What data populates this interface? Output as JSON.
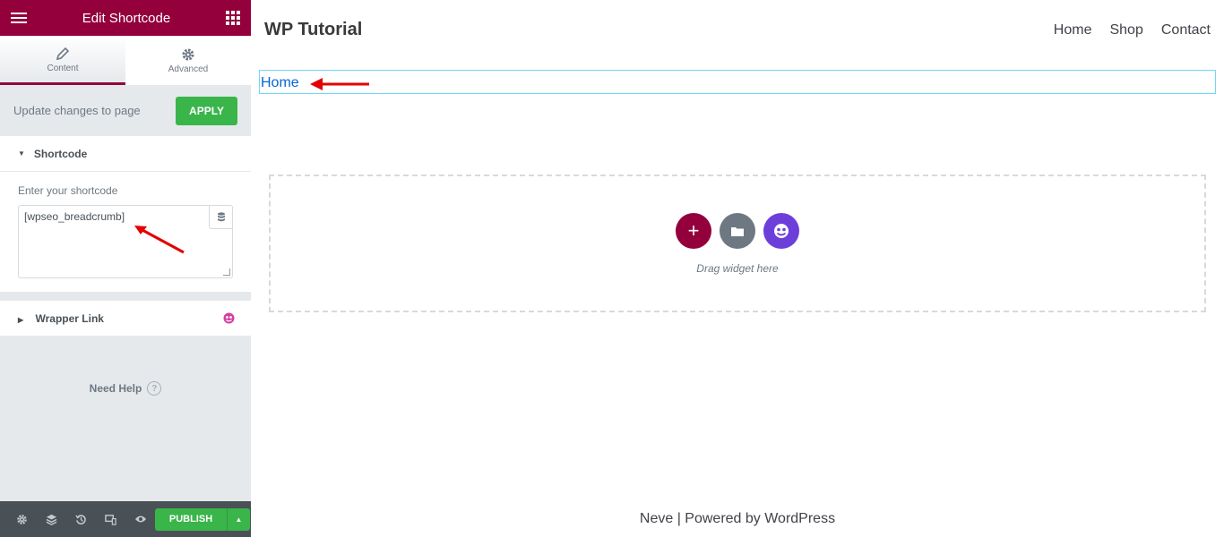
{
  "panel": {
    "header_title": "Edit Shortcode",
    "tabs": [
      {
        "label": "Content",
        "icon": "pencil-icon"
      },
      {
        "label": "Advanced",
        "icon": "gear-icon"
      }
    ],
    "apply_text": "Update changes to page",
    "apply_label": "APPLY",
    "shortcode_section": "Shortcode",
    "shortcode_field_label": "Enter your shortcode",
    "shortcode_value": "[wpseo_breadcrumb]",
    "wrapper_section": "Wrapper Link",
    "need_help": "Need Help",
    "publish_label": "PUBLISH"
  },
  "preview": {
    "site_title": "WP Tutorial",
    "nav": [
      "Home",
      "Shop",
      "Contact"
    ],
    "breadcrumb": "Home",
    "drag_text": "Drag widget here",
    "footer_text": "Neve | Powered by WordPress"
  },
  "colors": {
    "brand": "#93003c",
    "apply_green": "#39b54a",
    "link_blue": "#0366d6",
    "annotation_red": "#e30000"
  }
}
